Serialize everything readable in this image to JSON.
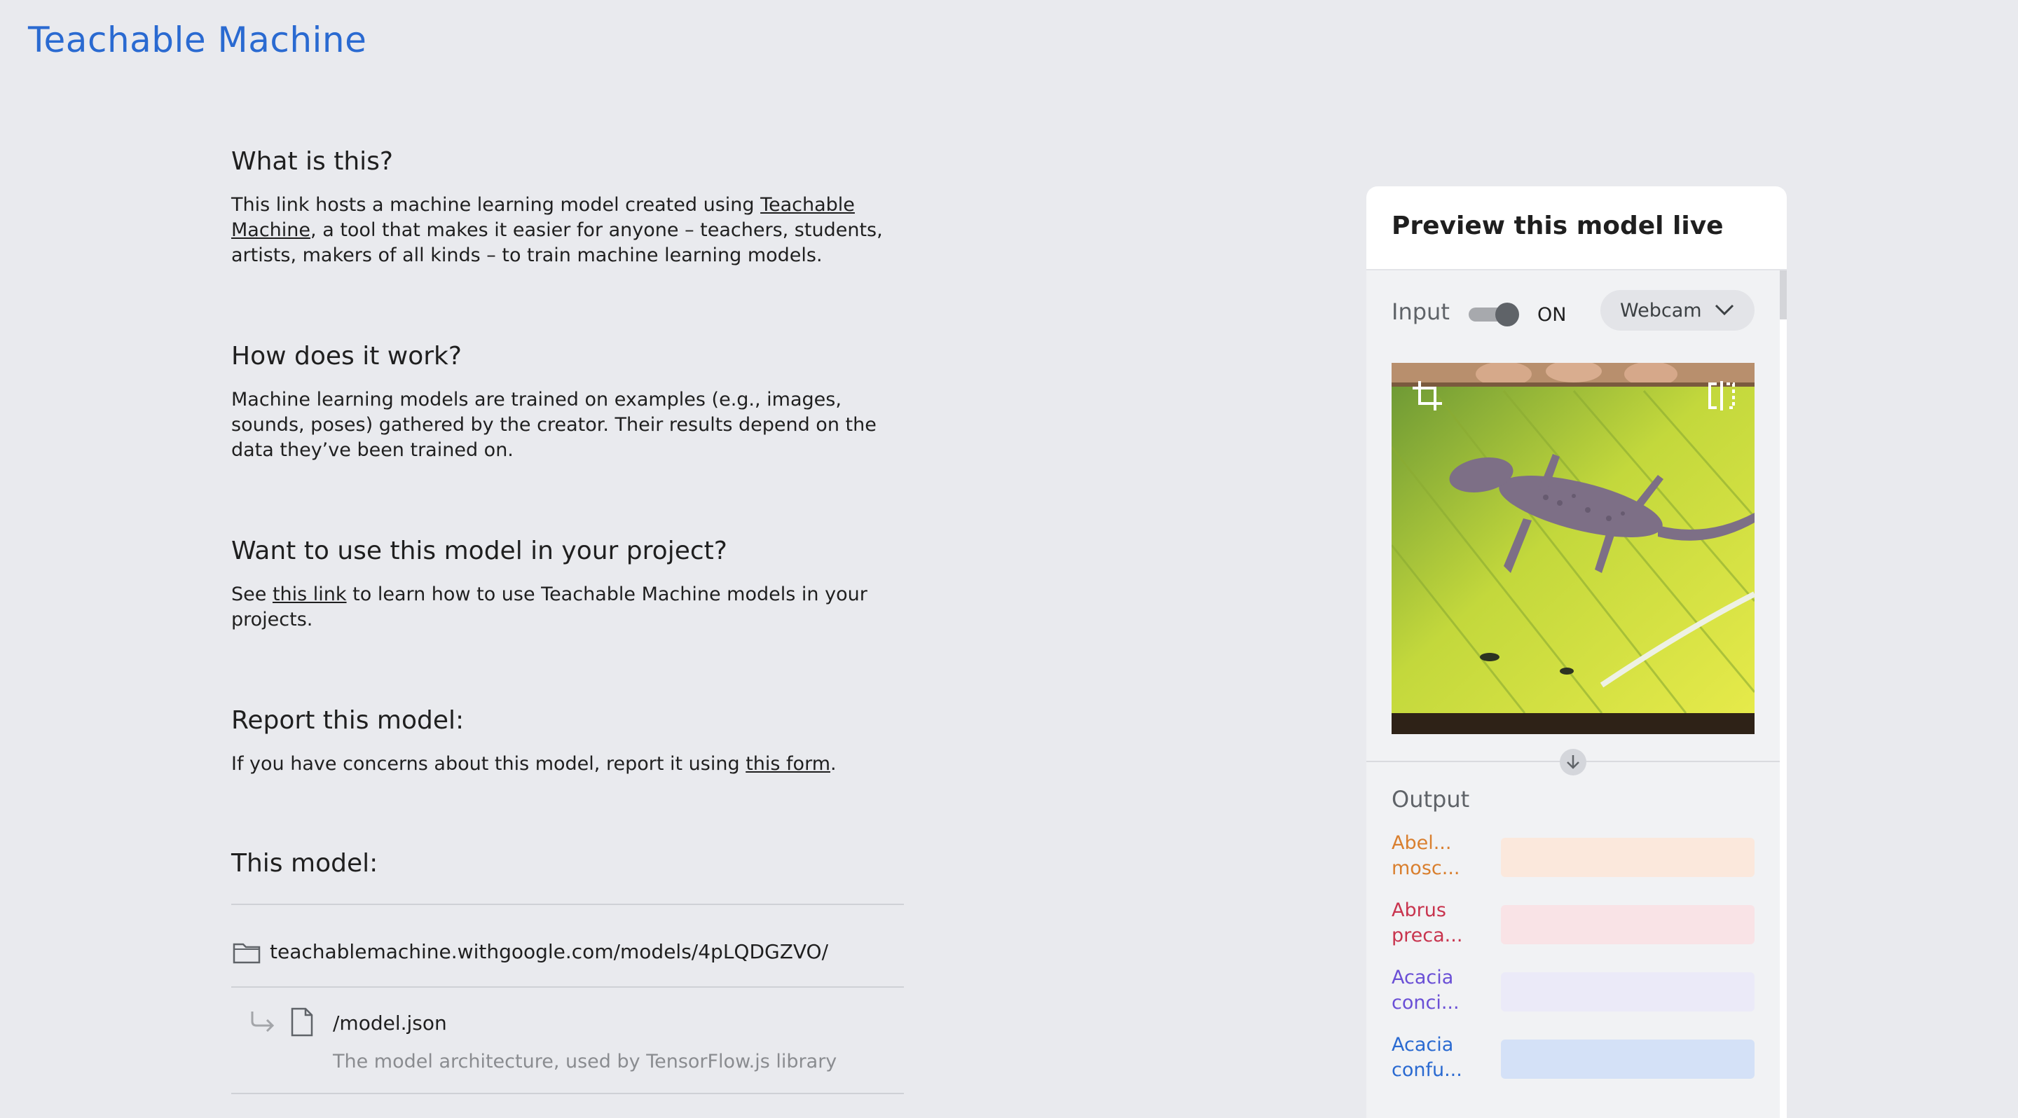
{
  "app": {
    "title": "Teachable Machine"
  },
  "sections": [
    {
      "heading": "What is this?",
      "text_before": "This link hosts a machine learning model created using ",
      "link": "Teachable Machine",
      "text_after": ", a tool that makes it easier for anyone – teachers, students, artists, makers of all kinds – to train machine learning models."
    },
    {
      "heading": "How does it work?",
      "text": "Machine learning models are trained on examples (e.g., images, sounds, poses) gathered by the creator. Their results depend on the data they’ve been trained on."
    },
    {
      "heading": "Want to use this model in your project?",
      "text_before": "See ",
      "link": "this link",
      "text_after": " to learn how to use Teachable Machine models in your projects."
    },
    {
      "heading": "Report this model:",
      "text_before": "If you have concerns about this model, report it using ",
      "link": "this form",
      "text_after": "."
    },
    {
      "heading": "This model:"
    }
  ],
  "model_files": {
    "folder": "teachablemachine.withgoogle.com/models/4pLQDGZVO/",
    "files": [
      {
        "name": "/model.json",
        "description": "The model architecture, used by TensorFlow.js library"
      }
    ]
  },
  "preview": {
    "title": "Preview this model live",
    "input_label": "Input",
    "toggle_state": "ON",
    "source": "Webcam",
    "output_label": "Output",
    "icons": [
      "crop-icon",
      "flip-icon",
      "arrow-down-icon",
      "chevron-down-icon",
      "folder-icon",
      "file-icon",
      "subdirectory-arrow-icon"
    ],
    "classes": [
      {
        "label": "Abel... mosc...",
        "color": "#d97f2e",
        "bar_color": "#fbe8dc",
        "confidence": 0
      },
      {
        "label": "Abrus preca...",
        "color": "#c8344e",
        "bar_color": "#f9e3e6",
        "confidence": 0
      },
      {
        "label": "Acacia conci...",
        "color": "#6a4fd6",
        "bar_color": "#ebeaf8",
        "confidence": 0
      },
      {
        "label": "Acacia confu...",
        "color": "#2a6ad1",
        "bar_color": "#d4e1f7",
        "confidence": 0
      }
    ]
  }
}
